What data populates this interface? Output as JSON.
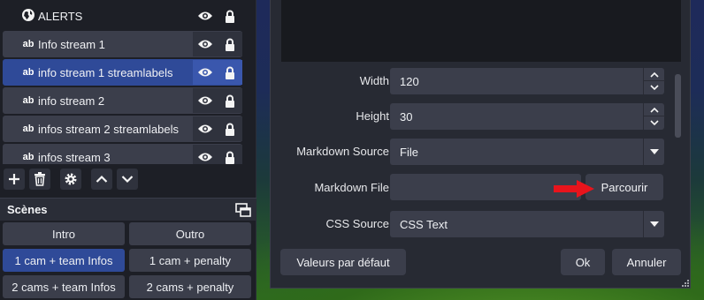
{
  "sources": {
    "items": [
      {
        "label": "ALERTS",
        "icon": "globe-icon",
        "state": "plain"
      },
      {
        "label": "Info stream 1",
        "icon": "text-ab-icon",
        "state": "normal"
      },
      {
        "label": "info stream 1 streamlabels",
        "icon": "text-ab-icon",
        "state": "selected"
      },
      {
        "label": "info stream 2",
        "icon": "text-ab-icon",
        "state": "normal"
      },
      {
        "label": "infos stream 2 streamlabels",
        "icon": "text-ab-icon",
        "state": "normal"
      },
      {
        "label": "infos stream 3",
        "icon": "text-ab-icon",
        "state": "normal"
      }
    ],
    "icon_text": "ab"
  },
  "scenes": {
    "title": "Scènes",
    "buttons": [
      {
        "label": "Intro",
        "active": false
      },
      {
        "label": "Outro",
        "active": false
      },
      {
        "label": "1 cam + team Infos",
        "active": true
      },
      {
        "label": "1 cam + penalty",
        "active": false
      },
      {
        "label": "2 cams + team Infos",
        "active": false
      },
      {
        "label": "2 cams + penalty",
        "active": false
      }
    ]
  },
  "properties": {
    "width": {
      "label": "Width",
      "value": "120"
    },
    "height": {
      "label": "Height",
      "value": "30"
    },
    "markdown_source": {
      "label": "Markdown Source",
      "value": "File"
    },
    "markdown_file": {
      "label": "Markdown File",
      "value": "",
      "browse_label": "Parcourir"
    },
    "css_source": {
      "label": "CSS Source",
      "value": "CSS Text"
    }
  },
  "footer": {
    "defaults_label": "Valeurs par défaut",
    "ok_label": "Ok",
    "cancel_label": "Annuler"
  },
  "colors": {
    "panel": "#1d1f26",
    "row": "#3b3e4b",
    "selected": "#2f4a98",
    "dialog": "#272a33",
    "arrow": "#e8141c"
  }
}
